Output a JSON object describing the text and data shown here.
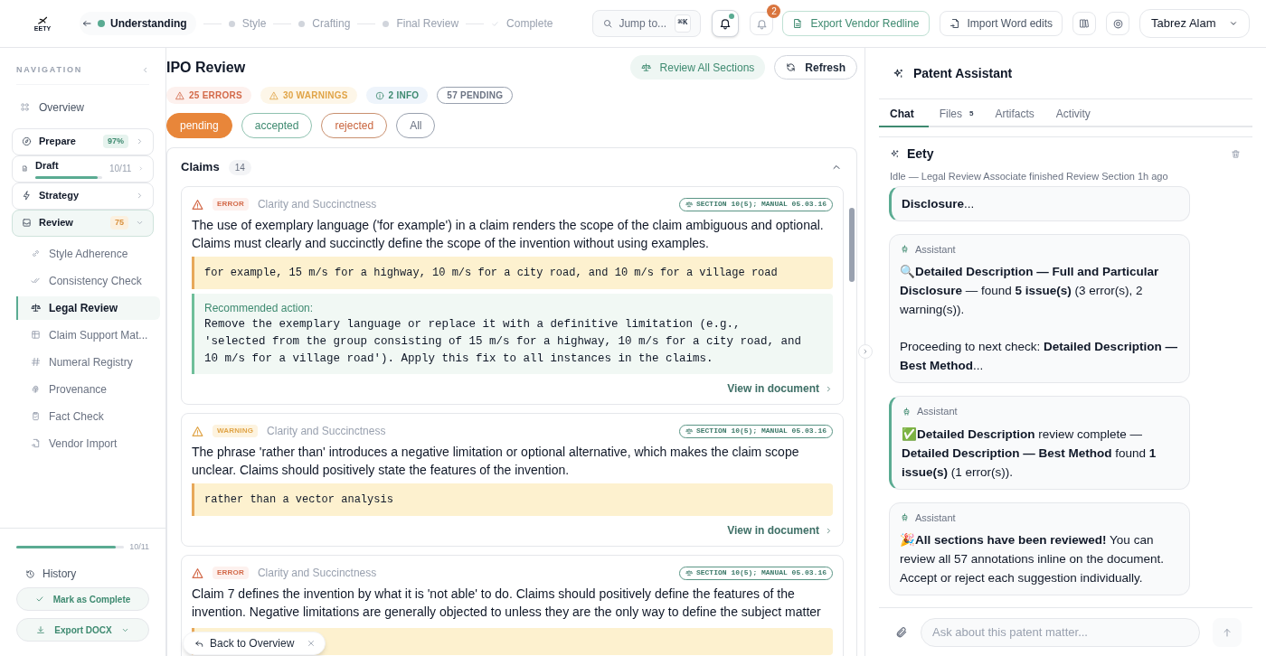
{
  "header": {
    "logo": "EETY",
    "steps": [
      {
        "label": "Understanding",
        "kind": "dot",
        "current": true
      },
      {
        "label": "Style",
        "kind": "dot",
        "current": false
      },
      {
        "label": "Crafting",
        "kind": "dot",
        "current": false
      },
      {
        "label": "Final Review",
        "kind": "dot",
        "current": false
      },
      {
        "label": "Complete",
        "kind": "check",
        "current": false
      }
    ],
    "jump": {
      "placeholder": "Jump to...",
      "shortcut": "⌘K"
    },
    "notification_badge": "2",
    "export_button": "Export Vendor Redline",
    "import_button": "Import Word edits",
    "user": "Tabrez Alam"
  },
  "sidebar": {
    "title": "NAVIGATION",
    "overview": "Overview",
    "groups": [
      {
        "label": "Prepare",
        "kind": "badge",
        "badge": "97%",
        "expanded": false
      },
      {
        "label": "Draft",
        "kind": "progress",
        "count": "10/11",
        "level": 0.93,
        "expanded": false
      },
      {
        "label": "Strategy",
        "kind": "plain",
        "expanded": false
      },
      {
        "label": "Review",
        "kind": "warn",
        "badge": "75",
        "expanded": true,
        "children": [
          {
            "label": "Style Adherence",
            "selected": false
          },
          {
            "label": "Consistency Check",
            "selected": false
          },
          {
            "label": "Legal Review",
            "selected": true
          },
          {
            "label": "Claim Support Mat...",
            "selected": false
          },
          {
            "label": "Numeral Registry",
            "selected": false
          },
          {
            "label": "Provenance",
            "selected": false
          },
          {
            "label": "Fact Check",
            "selected": false
          },
          {
            "label": "Vendor Import",
            "selected": false
          }
        ]
      }
    ],
    "progress": {
      "level": 0.92,
      "count": "10/11"
    },
    "history": "History",
    "complete_button": "Mark as Complete",
    "export_button": "Export DOCX"
  },
  "main": {
    "title": "IPO Review",
    "review_all": "Review All Sections",
    "refresh": "Refresh",
    "counts": [
      {
        "label": "25 ERRORS",
        "kind": "error"
      },
      {
        "label": "30 WARNINGS",
        "kind": "warning"
      },
      {
        "label": "2 INFO",
        "kind": "info"
      },
      {
        "label": "57 PENDING",
        "kind": "pending"
      }
    ],
    "filters": [
      {
        "label": "pending",
        "kind": "pending",
        "selected": true
      },
      {
        "label": "accepted",
        "kind": "accepted",
        "selected": false
      },
      {
        "label": "rejected",
        "kind": "rejected",
        "selected": false
      },
      {
        "label": "All",
        "kind": "all",
        "selected": false
      }
    ],
    "section": {
      "title": "Claims",
      "count": "14",
      "expanded": true,
      "issues": [
        {
          "kind": "error",
          "severity_label": "ERROR",
          "category": "Clarity and Succinctness",
          "reference": "SECTION 10(5); MANUAL 05.03.16",
          "message": "The use of exemplary language ('for example') in a claim renders the scope of the claim ambiguous and optional. Claims must clearly and succinctly define the scope of the invention without using examples.",
          "quote": "for example, 15 m/s for a highway, 10 m/s for a city road, and 10 m/s for a village road",
          "action_label": "Recommended action:",
          "action": "Remove the exemplary language or replace it with a definitive limitation (e.g., 'selected from the group consisting of 15 m/s for a highway, 10 m/s for a city road, and 10 m/s for a village road'). Apply this fix to all instances in the claims.",
          "link": "View in document"
        },
        {
          "kind": "warning",
          "severity_label": "WARNING",
          "category": "Clarity and Succinctness",
          "reference": "SECTION 10(5); MANUAL 05.03.16",
          "message": "The phrase 'rather than' introduces a negative limitation or optional alternative, which makes the claim scope unclear. Claims should positively state the features of the invention.",
          "quote": "rather than a vector analysis",
          "link": "View in document"
        },
        {
          "kind": "error",
          "severity_label": "ERROR",
          "category": "Clarity and Succinctness",
          "reference": "SECTION 10(5); MANUAL 05.03.16",
          "message": "Claim 7 defines the invention by what it is 'not able' to do. Claims should positively define the features of the invention. Negative limitations are generally objected to unless they are the only way to define the subject matter"
        }
      ]
    },
    "back_pill": "Back to Overview"
  },
  "assistant": {
    "title": "Patent Assistant",
    "tabs": [
      {
        "label": "Chat",
        "selected": true
      },
      {
        "label": "Files",
        "count": "5",
        "selected": false
      },
      {
        "label": "Artifacts",
        "selected": false
      },
      {
        "label": "Activity",
        "selected": false
      }
    ],
    "agent": "Eety",
    "status": "Idle — Legal Review Associate finished Review Section 1h ago",
    "messages": [
      {
        "highlight": true,
        "text": "**Disclosure**..."
      },
      {
        "author": "Assistant",
        "highlight": false,
        "text": "🔍**Detailed Description — Full and Particular Disclosure** — found **5 issue(s)** (3 error(s), 2 warning(s)).",
        "text_2": "Proceeding to next check: **Detailed Description — Best Method**..."
      },
      {
        "author": "Assistant",
        "highlight": true,
        "text": "✅**Detailed Description** review complete — **Detailed Description — Best Method** found **1 issue(s)** (1 error(s))."
      },
      {
        "author": "Assistant",
        "highlight": false,
        "text": "🎉**All sections have been reviewed!** You can review all 57 annotations inline on the document. Accept or reject each suggestion individually."
      }
    ],
    "input": {
      "placeholder": "Ask about this patent matter..."
    }
  }
}
